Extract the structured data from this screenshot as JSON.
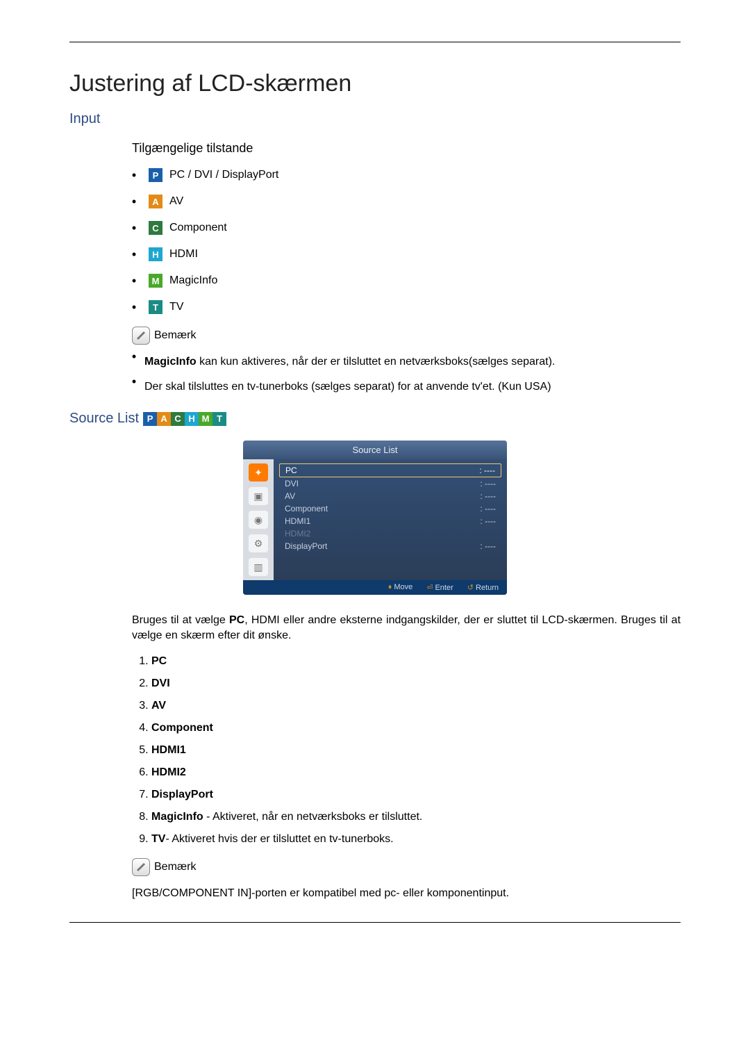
{
  "title": "Justering af LCD-skærmen",
  "input_heading": "Input",
  "modes_heading": "Tilgængelige tilstande",
  "modes": [
    {
      "badge": "P",
      "color": "bg-blue",
      "label": "PC / DVI / DisplayPort"
    },
    {
      "badge": "A",
      "color": "bg-orange",
      "label": "AV"
    },
    {
      "badge": "C",
      "color": "bg-dgreen",
      "label": "Component"
    },
    {
      "badge": "H",
      "color": "bg-cyan",
      "label": "HDMI"
    },
    {
      "badge": "M",
      "color": "bg-green",
      "label": "MagicInfo"
    },
    {
      "badge": "T",
      "color": "bg-teal",
      "label": "TV"
    }
  ],
  "note_label": "Bemærk",
  "notes_top": [
    {
      "bold": "MagicInfo",
      "text": " kan kun aktiveres, når der er tilsluttet en netværksboks(sælges separat)."
    },
    {
      "bold": "",
      "text": "Der skal tilsluttes en tv-tunerboks (sælges separat) for at anvende tv'et. (Kun USA)"
    }
  ],
  "source_list_heading": "Source List",
  "osd": {
    "header": "Source List",
    "items": [
      {
        "name": "PC",
        "val": ": ----",
        "sel": true
      },
      {
        "name": "DVI",
        "val": ": ----"
      },
      {
        "name": "AV",
        "val": ": ----"
      },
      {
        "name": "Component",
        "val": ": ----"
      },
      {
        "name": "HDMI1",
        "val": ": ----"
      },
      {
        "name": "HDMI2",
        "val": "",
        "dim": true
      },
      {
        "name": "DisplayPort",
        "val": ": ----"
      }
    ],
    "footer": {
      "move": "Move",
      "enter": "Enter",
      "ret": "Return"
    }
  },
  "source_desc_prefix": "Bruges til at vælge ",
  "source_desc_bold": "PC",
  "source_desc_suffix": ", HDMI eller andre eksterne indgangskilder, der er sluttet til LCD-skærmen. Bruges til at vælge en skærm efter dit ønske.",
  "ordered": [
    {
      "bold": "PC",
      "text": ""
    },
    {
      "bold": "DVI",
      "text": ""
    },
    {
      "bold": "AV",
      "text": ""
    },
    {
      "bold": "Component",
      "text": ""
    },
    {
      "bold": "HDMI1",
      "text": ""
    },
    {
      "bold": "HDMI2",
      "text": ""
    },
    {
      "bold": "DisplayPort",
      "text": ""
    },
    {
      "bold": "MagicInfo",
      "text": " - Aktiveret, når en netværksboks er tilsluttet."
    },
    {
      "bold": "TV",
      "text": "- Aktiveret hvis der er tilsluttet en tv-tunerboks."
    }
  ],
  "note2_text": "[RGB/COMPONENT IN]-porten er kompatibel med pc- eller komponentinput."
}
